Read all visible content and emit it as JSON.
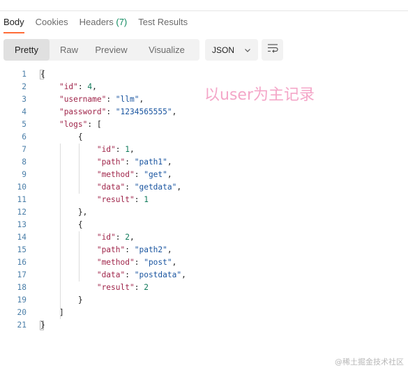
{
  "tabs": [
    {
      "label": "Body"
    },
    {
      "label": "Cookies"
    },
    {
      "label": "Headers",
      "count": "(7)"
    },
    {
      "label": "Test Results"
    }
  ],
  "view_modes": [
    "Pretty",
    "Raw",
    "Preview",
    "Visualize"
  ],
  "active_view": "Pretty",
  "format": {
    "selected": "JSON",
    "icon": "chevron-down-icon"
  },
  "wrap_icon": "wrap-lines-icon",
  "code_lines": [
    {
      "n": "1",
      "parts": [
        {
          "t": "{",
          "c": "p"
        }
      ]
    },
    {
      "n": "2",
      "parts": [
        {
          "t": "    ",
          "c": "p"
        },
        {
          "t": "\"id\"",
          "c": "k"
        },
        {
          "t": ": ",
          "c": "p"
        },
        {
          "t": "4",
          "c": "n"
        },
        {
          "t": ",",
          "c": "p"
        }
      ]
    },
    {
      "n": "3",
      "parts": [
        {
          "t": "    ",
          "c": "p"
        },
        {
          "t": "\"username\"",
          "c": "k"
        },
        {
          "t": ": ",
          "c": "p"
        },
        {
          "t": "\"llm\"",
          "c": "s"
        },
        {
          "t": ",",
          "c": "p"
        }
      ]
    },
    {
      "n": "4",
      "parts": [
        {
          "t": "    ",
          "c": "p"
        },
        {
          "t": "\"password\"",
          "c": "k"
        },
        {
          "t": ": ",
          "c": "p"
        },
        {
          "t": "\"1234565555\"",
          "c": "s"
        },
        {
          "t": ",",
          "c": "p"
        }
      ]
    },
    {
      "n": "5",
      "parts": [
        {
          "t": "    ",
          "c": "p"
        },
        {
          "t": "\"logs\"",
          "c": "k"
        },
        {
          "t": ": [",
          "c": "p"
        }
      ]
    },
    {
      "n": "6",
      "parts": [
        {
          "t": "        {",
          "c": "p"
        }
      ]
    },
    {
      "n": "7",
      "parts": [
        {
          "t": "            ",
          "c": "p"
        },
        {
          "t": "\"id\"",
          "c": "k"
        },
        {
          "t": ": ",
          "c": "p"
        },
        {
          "t": "1",
          "c": "n"
        },
        {
          "t": ",",
          "c": "p"
        }
      ]
    },
    {
      "n": "8",
      "parts": [
        {
          "t": "            ",
          "c": "p"
        },
        {
          "t": "\"path\"",
          "c": "k"
        },
        {
          "t": ": ",
          "c": "p"
        },
        {
          "t": "\"path1\"",
          "c": "s"
        },
        {
          "t": ",",
          "c": "p"
        }
      ]
    },
    {
      "n": "9",
      "parts": [
        {
          "t": "            ",
          "c": "p"
        },
        {
          "t": "\"method\"",
          "c": "k"
        },
        {
          "t": ": ",
          "c": "p"
        },
        {
          "t": "\"get\"",
          "c": "s"
        },
        {
          "t": ",",
          "c": "p"
        }
      ]
    },
    {
      "n": "10",
      "parts": [
        {
          "t": "            ",
          "c": "p"
        },
        {
          "t": "\"data\"",
          "c": "k"
        },
        {
          "t": ": ",
          "c": "p"
        },
        {
          "t": "\"getdata\"",
          "c": "s"
        },
        {
          "t": ",",
          "c": "p"
        }
      ]
    },
    {
      "n": "11",
      "parts": [
        {
          "t": "            ",
          "c": "p"
        },
        {
          "t": "\"result\"",
          "c": "k"
        },
        {
          "t": ": ",
          "c": "p"
        },
        {
          "t": "1",
          "c": "n"
        }
      ]
    },
    {
      "n": "12",
      "parts": [
        {
          "t": "        },",
          "c": "p"
        }
      ]
    },
    {
      "n": "13",
      "parts": [
        {
          "t": "        {",
          "c": "p"
        }
      ]
    },
    {
      "n": "14",
      "parts": [
        {
          "t": "            ",
          "c": "p"
        },
        {
          "t": "\"id\"",
          "c": "k"
        },
        {
          "t": ": ",
          "c": "p"
        },
        {
          "t": "2",
          "c": "n"
        },
        {
          "t": ",",
          "c": "p"
        }
      ]
    },
    {
      "n": "15",
      "parts": [
        {
          "t": "            ",
          "c": "p"
        },
        {
          "t": "\"path\"",
          "c": "k"
        },
        {
          "t": ": ",
          "c": "p"
        },
        {
          "t": "\"path2\"",
          "c": "s"
        },
        {
          "t": ",",
          "c": "p"
        }
      ]
    },
    {
      "n": "16",
      "parts": [
        {
          "t": "            ",
          "c": "p"
        },
        {
          "t": "\"method\"",
          "c": "k"
        },
        {
          "t": ": ",
          "c": "p"
        },
        {
          "t": "\"post\"",
          "c": "s"
        },
        {
          "t": ",",
          "c": "p"
        }
      ]
    },
    {
      "n": "17",
      "parts": [
        {
          "t": "            ",
          "c": "p"
        },
        {
          "t": "\"data\"",
          "c": "k"
        },
        {
          "t": ": ",
          "c": "p"
        },
        {
          "t": "\"postdata\"",
          "c": "s"
        },
        {
          "t": ",",
          "c": "p"
        }
      ]
    },
    {
      "n": "18",
      "parts": [
        {
          "t": "            ",
          "c": "p"
        },
        {
          "t": "\"result\"",
          "c": "k"
        },
        {
          "t": ": ",
          "c": "p"
        },
        {
          "t": "2",
          "c": "n"
        }
      ]
    },
    {
      "n": "19",
      "parts": [
        {
          "t": "        }",
          "c": "p"
        }
      ]
    },
    {
      "n": "20",
      "parts": [
        {
          "t": "    ]",
          "c": "p"
        }
      ]
    },
    {
      "n": "21",
      "parts": [
        {
          "t": "}",
          "c": "p"
        }
      ]
    }
  ],
  "annotation": "以user为主记录",
  "watermark": "@稀土掘金技术社区",
  "colors": {
    "accent": "#ff6c37",
    "count_green": "#0f8a5f",
    "key": "#a0264b",
    "string": "#1a55a0",
    "number": "#0f7a5a",
    "line_number": "#4a7ea8",
    "annotation": "#f4a6c8"
  }
}
